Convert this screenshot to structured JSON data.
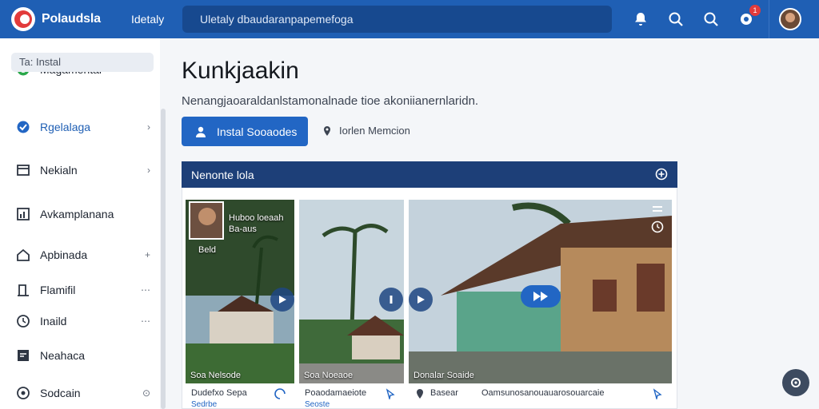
{
  "header": {
    "brand": "Polaudsla",
    "nav_link": "Idetaly",
    "search_text": "Uletaly dbaudaranpapemefoga",
    "notification_count": "1",
    "icons": [
      "bell-icon",
      "search-icon",
      "search-icon",
      "gear-icon",
      "avatar"
    ]
  },
  "sidebar": {
    "items": [
      {
        "label": "Magamental",
        "icon": "circle-check-icon",
        "trail": ""
      },
      {
        "label": "Ta: Instal",
        "icon": "",
        "trail": ""
      },
      {
        "label": "Rgelalaga",
        "icon": "check-badge-icon",
        "trail": "›"
      },
      {
        "label": "Nekialn",
        "icon": "window-icon",
        "trail": "›"
      },
      {
        "label": "Avkamplanana",
        "icon": "chart-icon",
        "trail": ""
      },
      {
        "label": "Apbinada",
        "icon": "home-icon",
        "trail": "+"
      },
      {
        "label": "Flamifil",
        "icon": "door-icon",
        "trail": "⋯"
      },
      {
        "label": "Inaild",
        "icon": "clock-icon",
        "trail": "⋯"
      },
      {
        "label": "Neahaca",
        "icon": "message-icon",
        "trail": ""
      },
      {
        "label": "Sodcain",
        "icon": "settings-icon",
        "trail": "⊙"
      }
    ]
  },
  "main": {
    "title": "Kunkjaakin",
    "subtitle": "Nenangjaoaraldanlstamonalnade tioe akoniianernlaridn.",
    "primary_button": "Instal Sooaodes",
    "location_label": "Iorlen Memcion",
    "panel_title": "Nenonte lola",
    "cards": [
      {
        "profile_text_1": "Huboo loeaah",
        "profile_text_2": "Ba-aus",
        "overlay_tag": "Beld",
        "caption": "Soa Nelsode",
        "meta_title": "Dudefxo Sepa",
        "meta_sub": "Sedrbe"
      },
      {
        "caption": "Soa Noeaoe",
        "meta_title": "Poaodamaeiote",
        "meta_sub": "Seoste"
      },
      {
        "caption": "Donalar Soaide",
        "meta_title": "Basear",
        "meta_extra": "Oamsunosanouauarosouarcaie"
      }
    ]
  },
  "colors": {
    "topbar": "#1f5fb4",
    "accent": "#2266c4",
    "panel_header": "#1d3f78",
    "badge": "#e23b3b"
  }
}
